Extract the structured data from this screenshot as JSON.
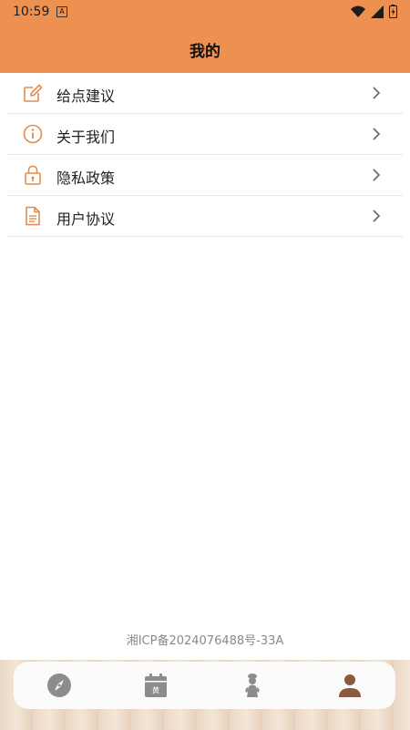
{
  "status": {
    "time": "10:59",
    "notification_glyph": "A"
  },
  "header": {
    "title": "我的"
  },
  "menu": {
    "items": [
      {
        "label": "给点建议",
        "icon": "edit-icon"
      },
      {
        "label": "关于我们",
        "icon": "info-icon"
      },
      {
        "label": "隐私政策",
        "icon": "lock-icon"
      },
      {
        "label": "用户协议",
        "icon": "document-icon"
      }
    ]
  },
  "footer": {
    "icp": "湘ICP备2024076488号-33A"
  },
  "nav": {
    "items": [
      {
        "icon": "compass-icon",
        "active": false
      },
      {
        "icon": "calendar-icon",
        "active": false,
        "badge": "黄"
      },
      {
        "icon": "figure-icon",
        "active": false
      },
      {
        "icon": "user-icon",
        "active": true
      }
    ]
  },
  "colors": {
    "accent": "#ee9150",
    "icon_orange": "#e38b4e",
    "active_nav": "#8a5a3c",
    "inactive_nav": "#8c8c8c"
  }
}
